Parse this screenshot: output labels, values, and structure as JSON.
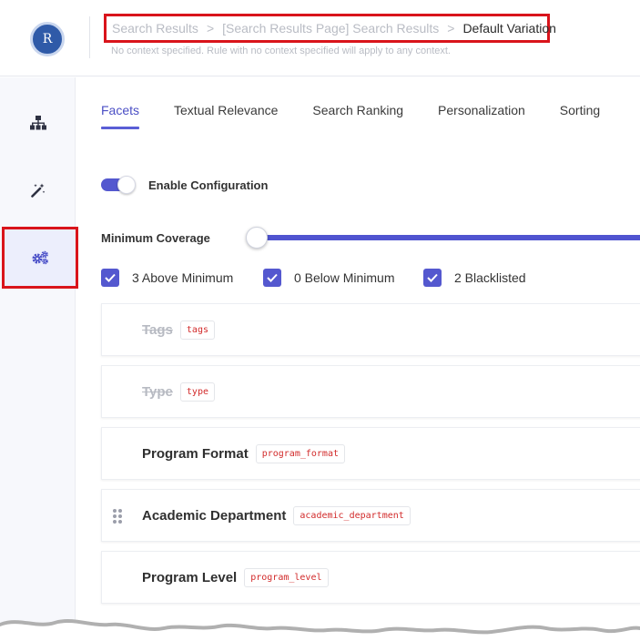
{
  "header": {
    "avatar_initial": "R",
    "breadcrumb": [
      "Search Results",
      "[Search Results Page] Search Results",
      "Default Variation"
    ],
    "breadcrumb_separator": ">",
    "context_note": "No context specified. Rule with no context specified will apply to any context."
  },
  "sidebar": {
    "items": [
      {
        "name": "sitemap",
        "icon": "sitemap-icon",
        "active": false
      },
      {
        "name": "magic-wand",
        "icon": "magic-wand-icon",
        "active": false
      },
      {
        "name": "settings",
        "icon": "gears-icon",
        "active": true
      }
    ]
  },
  "tabs": [
    {
      "label": "Facets",
      "active": true
    },
    {
      "label": "Textual Relevance",
      "active": false
    },
    {
      "label": "Search Ranking",
      "active": false
    },
    {
      "label": "Personalization",
      "active": false
    },
    {
      "label": "Sorting",
      "active": false
    }
  ],
  "config": {
    "enable_label": "Enable Configuration",
    "enabled": true
  },
  "coverage": {
    "label": "Minimum Coverage",
    "value_fraction": 0
  },
  "filters": [
    {
      "label": "3 Above Minimum",
      "checked": true
    },
    {
      "label": "0 Below Minimum",
      "checked": true
    },
    {
      "label": "2 Blacklisted",
      "checked": true
    }
  ],
  "facets": [
    {
      "name": "Tags",
      "code": "tags",
      "blacklisted": true
    },
    {
      "name": "Type",
      "code": "type",
      "blacklisted": true
    },
    {
      "name": "Program Format",
      "code": "program_format",
      "blacklisted": false
    },
    {
      "name": "Academic Department",
      "code": "academic_department",
      "blacklisted": false,
      "draggable": true
    },
    {
      "name": "Program Level",
      "code": "program_level",
      "blacklisted": false
    }
  ],
  "colors": {
    "accent": "#5458cf",
    "highlight_box": "#d9141b",
    "avatar": "#2f5aa8",
    "code_text": "#d22b2b"
  }
}
